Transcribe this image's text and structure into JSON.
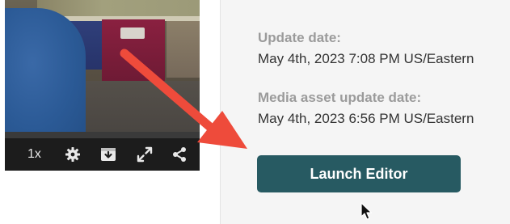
{
  "player": {
    "speed_label": "1x",
    "controls": [
      {
        "icon": "gear-icon"
      },
      {
        "icon": "download-icon"
      },
      {
        "icon": "fullscreen-icon"
      },
      {
        "icon": "share-icon"
      }
    ]
  },
  "details": {
    "update_date_label": "Update date:",
    "update_date_value": "May 4th, 2023 7:08 PM US/Eastern",
    "media_update_label": "Media asset update date:",
    "media_update_value": "May 4th, 2023 6:56 PM US/Eastern",
    "launch_button_label": "Launch Editor"
  },
  "colors": {
    "button_bg": "#275a62",
    "annotation_arrow": "#ee4b3b",
    "label_gray": "#9b9b9b",
    "value_dark": "#333333"
  }
}
